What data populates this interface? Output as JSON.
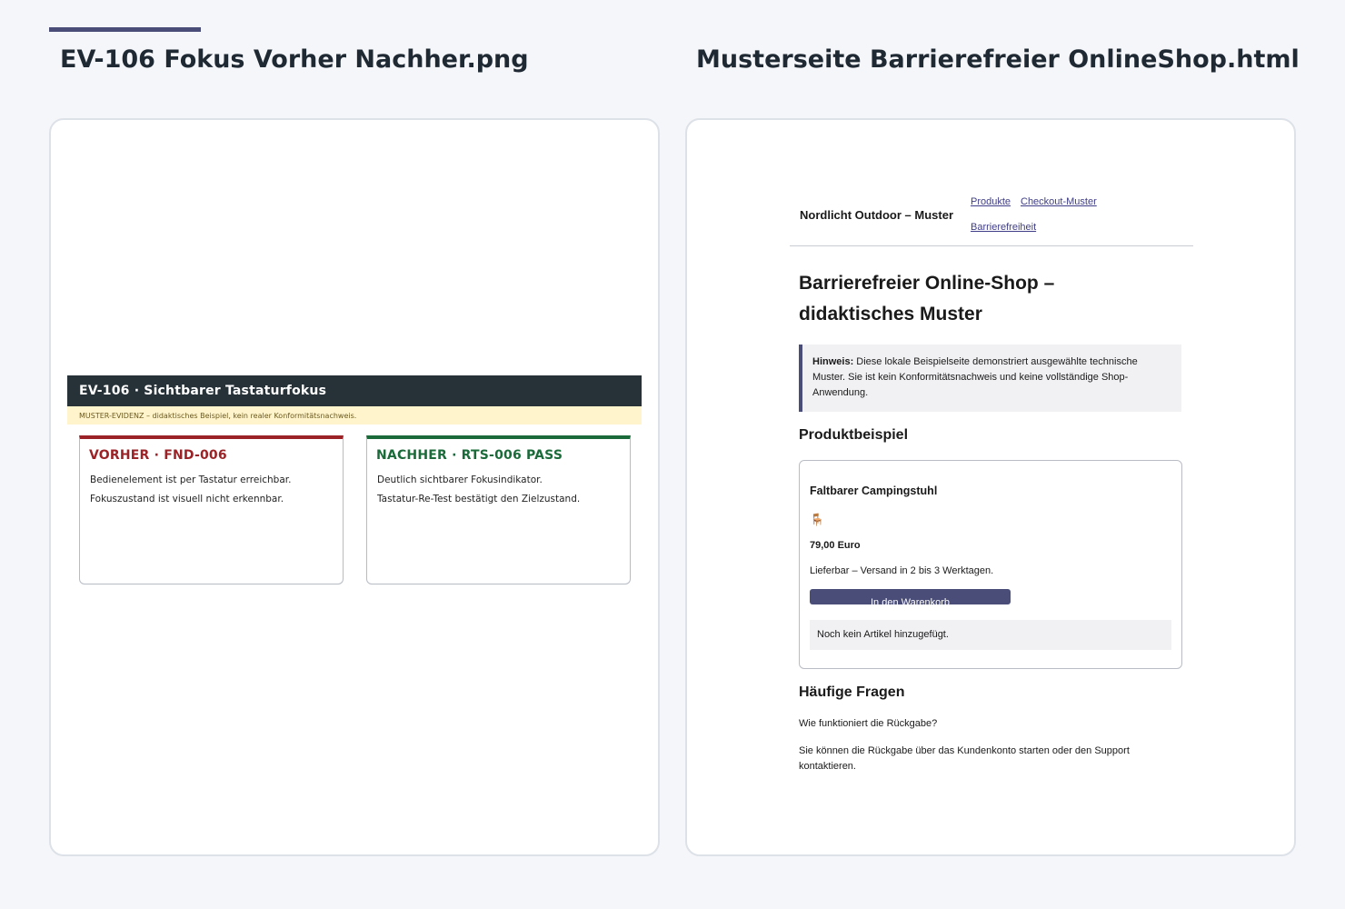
{
  "columns": {
    "left_title": "EV-106 Fokus Vorher Nachher.png",
    "right_title": "Musterseite Barrierefreier OnlineShop.html"
  },
  "evidence": {
    "header": "EV-106 · Sichtbarer Tastaturfokus",
    "banner": "MUSTER-EVIDENZ – didaktisches Beispiel, kein realer Konformitätsnachweis.",
    "before": {
      "title": "VORHER · FND-006",
      "lines": [
        "Bedienelement ist per Tastatur erreichbar.",
        "Fokuszustand ist visuell nicht erkennbar."
      ]
    },
    "after": {
      "title": "NACHHER · RTS-006 PASS",
      "lines": [
        "Deutlich sichtbarer Fokusindikator.",
        "Tastatur-Re-Test bestätigt den Zielzustand."
      ]
    },
    "colors": {
      "before": "#9b2226",
      "after": "#1b6b3a",
      "header_bg": "#263238",
      "banner_bg": "#fff4cc"
    }
  },
  "shop": {
    "brand": "Nordlicht Outdoor – Muster",
    "nav": [
      "Produkte",
      "Checkout-Muster",
      "Barrierefreiheit"
    ],
    "h1": "Barrierefreier Online-Shop – didaktisches Muster",
    "hint_label": "Hinweis:",
    "hint_text": " Diese lokale Beispielseite demonstriert ausgewählte technische Muster. Sie ist kein Konformitätsnachweis und keine vollständige Shop-Anwendung.",
    "product_heading": "Produktbeispiel",
    "product": {
      "name": "Faltbarer Campingstuhl",
      "icon": "chair-icon",
      "icon_glyph": "🪑",
      "price": "79,00 Euro",
      "stock": "Lieferbar – Versand in 2 bis 3 Werktagen.",
      "cart_button": "In den Warenkorb",
      "cart_status": "Noch kein Artikel hinzugefügt."
    },
    "faq_heading": "Häufige Fragen",
    "faq_question": "Wie funktioniert die Rückgabe?",
    "faq_answer": "Sie können die Rückgabe über das Kundenkonto starten oder den Support kontaktieren.",
    "accent_color": "#4a4d78"
  }
}
